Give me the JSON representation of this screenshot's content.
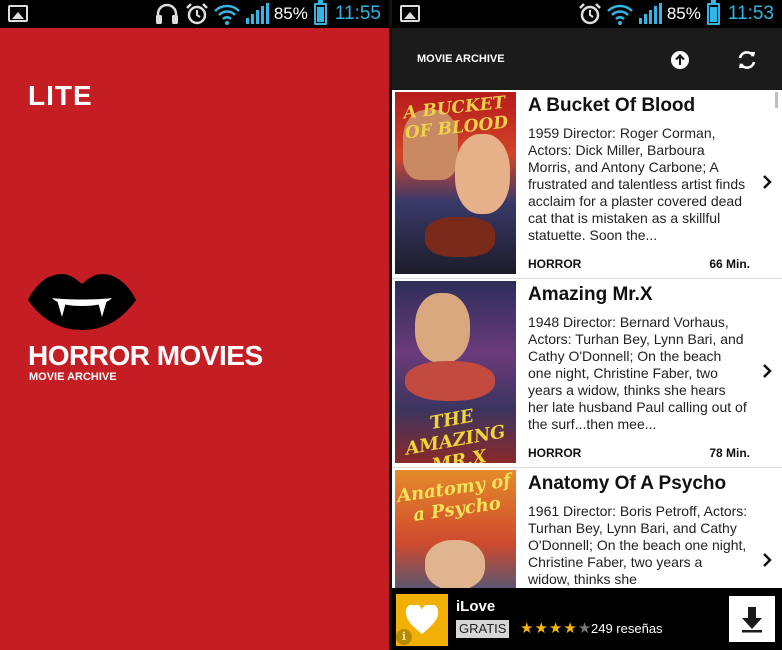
{
  "left_screen": {
    "status": {
      "battery": "85%",
      "time": "11:55",
      "battery_level": 0.85
    },
    "badge": "LITE",
    "app_title": "HORROR MOVIES",
    "app_subtitle": "MOVIE ARCHIVE",
    "logo_icon": "vampire-lips-icon"
  },
  "right_screen": {
    "status": {
      "battery": "85%",
      "time": "11:53",
      "battery_level": 0.85
    },
    "action_bar": {
      "title": "MOVIE ARCHIVE",
      "upload_icon": "arrow-up-circle-icon",
      "refresh_icon": "refresh-icon"
    },
    "movies": [
      {
        "title": "A Bucket Of Blood",
        "description": "1959 Director: Roger Corman, Actors: Dick Miller, Barboura Morris, and Antony Carbone; A frustrated and talentless artist finds acclaim for a plaster covered dead cat that is mistaken as a skillful statuette. Soon the...",
        "genre": "HORROR",
        "length": "66 Min."
      },
      {
        "title": "Amazing Mr.X",
        "description": "1948 Director: Bernard Vorhaus, Actors: Turhan Bey, Lynn Bari, and Cathy O'Donnell; On the beach one night, Christine Faber, two years a widow, thinks she hears her late husband Paul calling out of the surf...then mee...",
        "genre": "HORROR",
        "length": "78 Min."
      },
      {
        "title": "Anatomy Of A Psycho",
        "description": "1961 Director: Boris Petroff, Actors: Turhan Bey, Lynn Bari, and Cathy O'Donnell; On the beach one night, Christine Faber, two years a widow, thinks she",
        "genre": "",
        "length": ""
      }
    ],
    "ad": {
      "name": "iLove",
      "price": "GRATIS",
      "rating": 4,
      "max_rating": 5,
      "reviews": "249 reseñas",
      "icon": "heart-icon",
      "download_icon": "download-arrow-icon",
      "info_icon": "info-icon"
    }
  },
  "colors": {
    "splash_red": "#c41e24",
    "status_blue": "#33b5e5",
    "ad_yellow": "#f2b007"
  }
}
